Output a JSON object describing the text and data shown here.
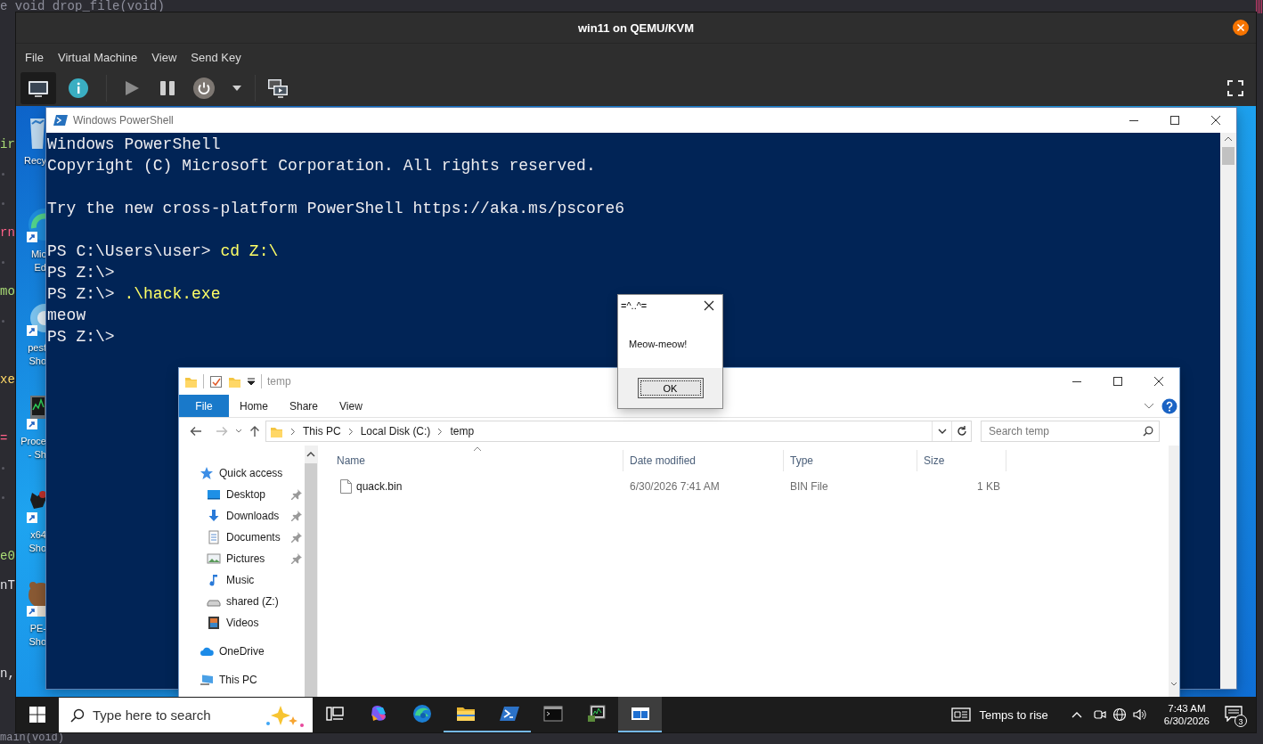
{
  "editor": {
    "lines": [
      {
        "kind": "code",
        "text": "e void drop_file(void)",
        "color": "#8e8f9c"
      },
      {
        "kind": "blank"
      },
      {
        "kind": "blank"
      },
      {
        "kind": "blank"
      },
      {
        "kind": "blank"
      },
      {
        "kind": "code",
        "text": "ir",
        "color": "#a9dc76"
      },
      {
        "kind": "dots"
      },
      {
        "kind": "dots"
      },
      {
        "kind": "code",
        "text": "rn",
        "color": "#ff6188"
      },
      {
        "kind": "dots"
      },
      {
        "kind": "code",
        "text": "mo",
        "color": "#a9dc76"
      },
      {
        "kind": "dots"
      },
      {
        "kind": "blank"
      },
      {
        "kind": "code",
        "text": "xe",
        "color": "#ffd866"
      },
      {
        "kind": "blank"
      },
      {
        "kind": "code",
        "text": "=",
        "color": "#ff6188"
      },
      {
        "kind": "dots"
      },
      {
        "kind": "dots"
      },
      {
        "kind": "blank"
      },
      {
        "kind": "code",
        "text": "e0",
        "color": "#a9dc76"
      },
      {
        "kind": "code",
        "text": "nT",
        "color": "#e3e3e8"
      },
      {
        "kind": "blank"
      },
      {
        "kind": "blank"
      },
      {
        "kind": "code",
        "text": "n,",
        "color": "#e3e3e8"
      },
      {
        "kind": "blank"
      },
      {
        "kind": "code",
        "text": "main(void)",
        "color": "#8e8f9c"
      }
    ]
  },
  "vm": {
    "title": "win11 on QEMU/KVM",
    "menu": [
      "File",
      "Virtual Machine",
      "View",
      "Send Key"
    ],
    "view_buttons": [
      {
        "selected": true
      },
      {
        "selected": false
      }
    ]
  },
  "desktop_icons": [
    {
      "label": [
        "Recy"
      ],
      "shortcut": false
    },
    {
      "label": [
        "Mic",
        "Ed"
      ],
      "shortcut": true
    },
    {
      "label": [
        "pest",
        "Sho"
      ],
      "shortcut": true
    },
    {
      "label": [
        "Proce",
        "- Sh"
      ],
      "shortcut": true
    },
    {
      "label": [
        "x64",
        "Sho"
      ],
      "shortcut": true
    },
    {
      "label": [
        "PE-",
        "Sho"
      ],
      "shortcut": true
    }
  ],
  "powershell": {
    "title": "Windows PowerShell",
    "lines": [
      {
        "kind": "output",
        "text": "Windows PowerShell"
      },
      {
        "kind": "output",
        "text": "Copyright (C) Microsoft Corporation. All rights reserved."
      },
      {
        "kind": "blank"
      },
      {
        "kind": "output",
        "text": "Try the new cross-platform PowerShell https://aka.ms/pscore6"
      },
      {
        "kind": "blank"
      },
      {
        "kind": "prompt",
        "prompt": "PS C:\\Users\\user>",
        "command": "cd Z:\\"
      },
      {
        "kind": "prompt",
        "prompt": "PS Z:\\>"
      },
      {
        "kind": "prompt",
        "prompt": "PS Z:\\>",
        "command": ".\\hack.exe"
      },
      {
        "kind": "output",
        "text": "meow"
      },
      {
        "kind": "prompt",
        "prompt": "PS Z:\\>"
      }
    ]
  },
  "message_box": {
    "title": "=^..^=",
    "message": "Meow-meow!",
    "button": "OK"
  },
  "explorer": {
    "title": "temp",
    "ribbon_tabs": [
      {
        "label": "File",
        "selected": true
      },
      {
        "label": "Home",
        "selected": false
      },
      {
        "label": "Share",
        "selected": false
      },
      {
        "label": "View",
        "selected": false
      }
    ],
    "breadcrumb": [
      "This PC",
      "Local Disk (C:)",
      "temp"
    ],
    "search": {
      "placeholder": "Search temp"
    },
    "nav": [
      {
        "label": "Quick access",
        "children": [
          {
            "label": "Desktop",
            "pinned": true
          },
          {
            "label": "Downloads",
            "pinned": true
          },
          {
            "label": "Documents",
            "pinned": true
          },
          {
            "label": "Pictures",
            "pinned": true
          },
          {
            "label": "Music",
            "pinned": false
          },
          {
            "label": "shared (Z:)",
            "pinned": false
          },
          {
            "label": "Videos",
            "pinned": false
          }
        ]
      },
      {
        "label": "OneDrive"
      },
      {
        "label": "This PC"
      }
    ],
    "columns": [
      "Name",
      "Date modified",
      "Type",
      "Size"
    ],
    "rows": [
      [
        "quack.bin",
        "6/30/2026 7:41 AM",
        "BIN File",
        "1 KB"
      ]
    ]
  },
  "taskbar": {
    "search_placeholder": "Type here to search",
    "apps": [
      {
        "running": false,
        "selected": false
      },
      {
        "running": false,
        "selected": false
      },
      {
        "running": false,
        "selected": false
      },
      {
        "running": true,
        "selected": false
      },
      {
        "running": true,
        "selected": false
      },
      {
        "running": false,
        "selected": false
      },
      {
        "running": false,
        "selected": false
      },
      {
        "running": true,
        "selected": true
      }
    ],
    "weather": "Temps to rise",
    "time": "7:43 AM",
    "date": "6/30/2026",
    "notifications": "3"
  }
}
